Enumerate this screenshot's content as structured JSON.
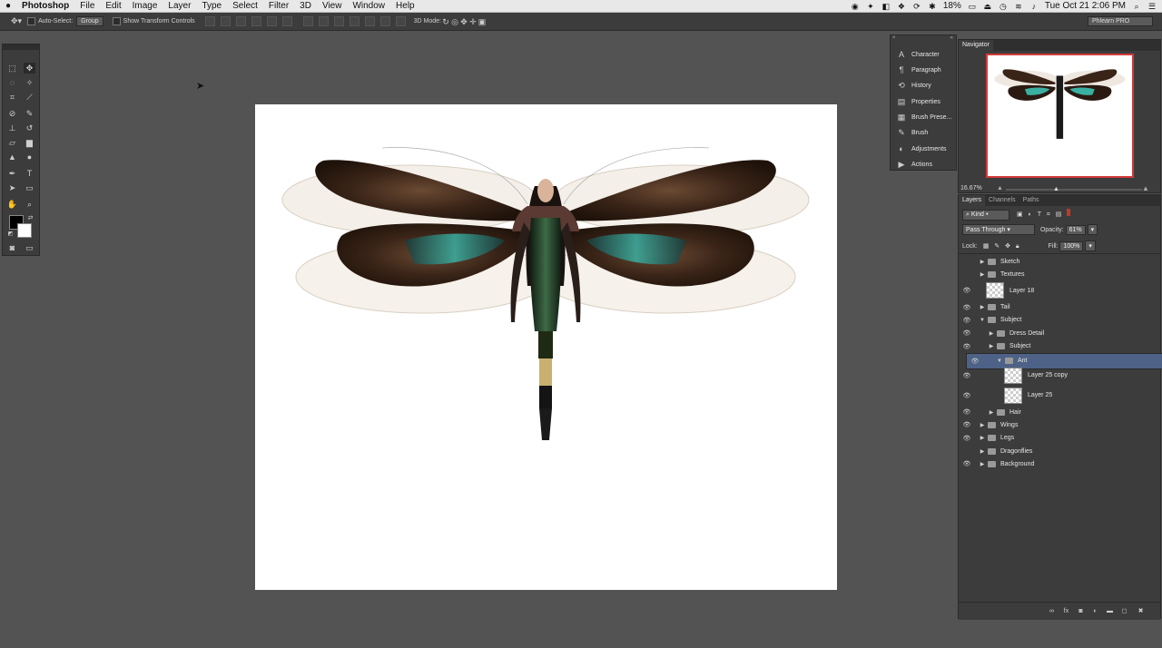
{
  "menubar": {
    "apple": "",
    "app": "Photoshop",
    "items": [
      "File",
      "Edit",
      "Image",
      "Layer",
      "Type",
      "Select",
      "Filter",
      "3D",
      "View",
      "Window",
      "Help"
    ],
    "battery": "18%",
    "clock": "Tue Oct 21  2:06 PM"
  },
  "options": {
    "auto_select": "Auto-Select:",
    "group_value": "Group",
    "show_transform": "Show Transform Controls",
    "mode_3d": "3D Mode:",
    "workspace": "Phlearn PRO"
  },
  "dock": {
    "items": [
      {
        "label": "Character",
        "icon": "A"
      },
      {
        "label": "Paragraph",
        "icon": "¶"
      },
      {
        "label": "History",
        "icon": "⟲"
      },
      {
        "label": "Properties",
        "icon": "▤"
      },
      {
        "label": "Brush Prese...",
        "icon": "▦"
      },
      {
        "label": "Brush",
        "icon": "✎"
      },
      {
        "label": "Adjustments",
        "icon": "◐"
      },
      {
        "label": "Actions",
        "icon": "▶"
      }
    ]
  },
  "navigator": {
    "tab": "Navigator",
    "zoom": "16.67%"
  },
  "layers_panel": {
    "tabs": [
      "Layers",
      "Channels",
      "Paths"
    ],
    "filter": "Kind",
    "blend_mode": "Pass Through",
    "opacity_label": "Opacity:",
    "opacity": "61%",
    "lock_label": "Lock:",
    "fill_label": "Fill:",
    "fill": "100%",
    "layers": [
      {
        "name": "Sketch",
        "type": "folder",
        "visible": false,
        "open": false,
        "indent": 0
      },
      {
        "name": "Textures",
        "type": "folder",
        "visible": false,
        "open": false,
        "indent": 0
      },
      {
        "name": "Layer 18",
        "type": "layer",
        "visible": true,
        "indent": 0
      },
      {
        "name": "Tail",
        "type": "folder",
        "visible": true,
        "open": false,
        "indent": 0
      },
      {
        "name": "Subject",
        "type": "folder",
        "visible": true,
        "open": true,
        "indent": 0
      },
      {
        "name": "Dress Detail",
        "type": "folder",
        "visible": true,
        "open": false,
        "indent": 1
      },
      {
        "name": "Subject",
        "type": "folder",
        "visible": true,
        "open": false,
        "indent": 1
      },
      {
        "name": "Ant",
        "type": "folder",
        "visible": true,
        "open": true,
        "indent": 1,
        "selected": true
      },
      {
        "name": "Layer 25 copy",
        "type": "layer",
        "visible": true,
        "indent": 2
      },
      {
        "name": "Layer 25",
        "type": "layer",
        "visible": true,
        "indent": 2
      },
      {
        "name": "Hair",
        "type": "folder",
        "visible": true,
        "open": false,
        "indent": 1
      },
      {
        "name": "Wings",
        "type": "folder",
        "visible": true,
        "open": false,
        "indent": 0
      },
      {
        "name": "Legs",
        "type": "folder",
        "visible": true,
        "open": false,
        "indent": 0
      },
      {
        "name": "Dragonflies",
        "type": "folder",
        "visible": false,
        "open": false,
        "indent": 0
      },
      {
        "name": "Background",
        "type": "folder",
        "visible": true,
        "open": false,
        "indent": 0
      }
    ]
  },
  "colors": {
    "accent_selected": "#4d6286",
    "navigator_frame": "#d23a3a",
    "wing_dark": "#3a2418",
    "wing_teal": "#2f8f86"
  }
}
